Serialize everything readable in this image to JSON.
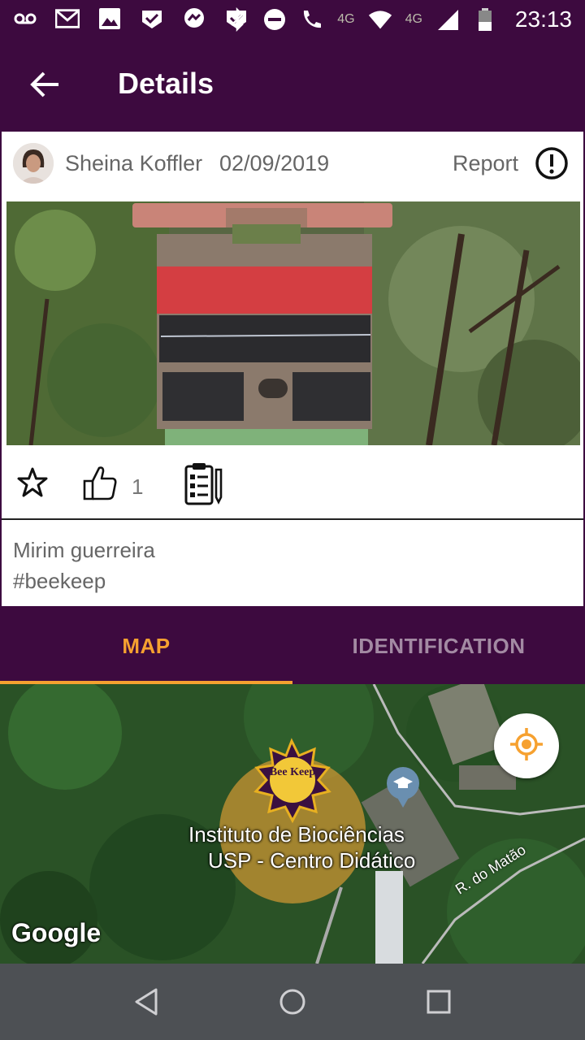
{
  "status_bar": {
    "time": "23:13",
    "network_left": "4G",
    "network_right": "4G"
  },
  "app_bar": {
    "title": "Details"
  },
  "post": {
    "author": "Sheina Koffler",
    "date": "02/09/2019",
    "report_label": "Report",
    "likes": "1",
    "description_lines": [
      "Mirim guerreira",
      "#beekeep"
    ]
  },
  "tabs": [
    {
      "label": "MAP",
      "selected": true
    },
    {
      "label": "IDENTIFICATION",
      "selected": false
    }
  ],
  "map": {
    "place_line1": "Instituto de Biociências",
    "place_line2": "USP - Centro Didático",
    "road_label": "R. do Matão",
    "attribution": "Google",
    "marker_text": "Bee Keep"
  },
  "colors": {
    "primary": "#3d0a3f",
    "accent": "#f6a130"
  },
  "icons": [
    "back-arrow-icon",
    "report-icon",
    "star-icon",
    "like-icon",
    "clipboard-icon",
    "locate-icon",
    "nav-back-icon",
    "nav-home-icon",
    "nav-recents-icon"
  ]
}
